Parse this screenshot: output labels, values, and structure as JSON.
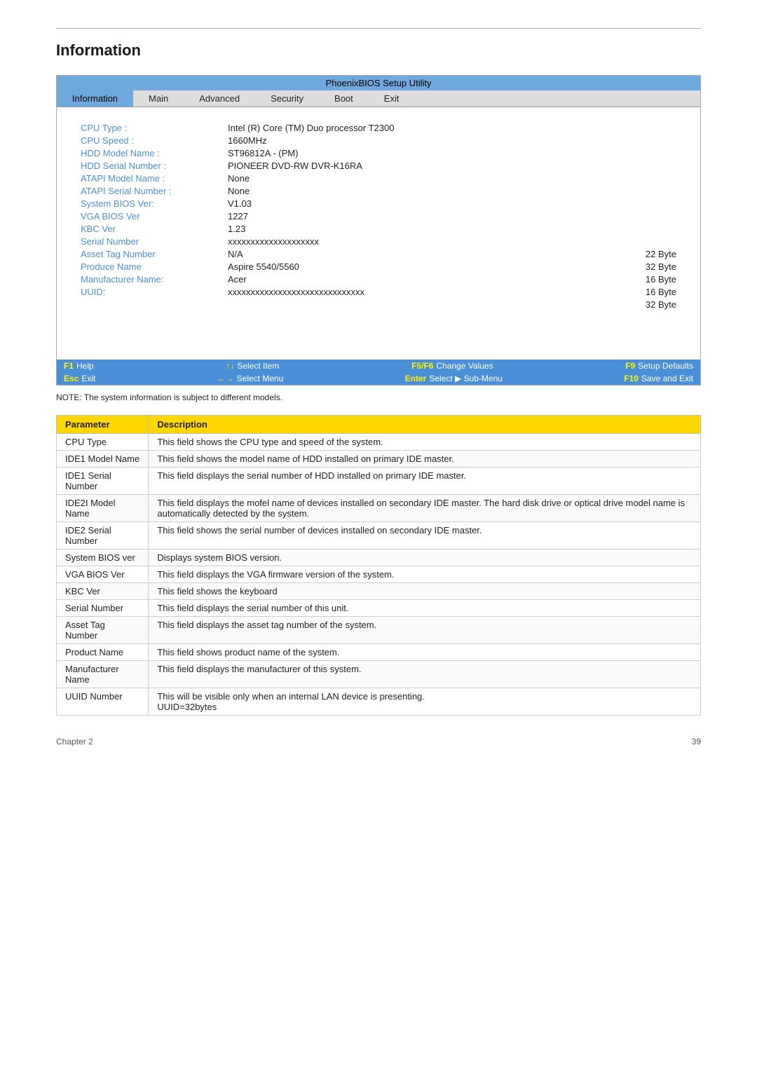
{
  "page": {
    "title": "Information",
    "chapter": "Chapter 2",
    "page_number": "39"
  },
  "bios": {
    "title_bar": "PhoenixBIOS Setup Utility",
    "nav_items": [
      {
        "label": "Information",
        "active": true
      },
      {
        "label": "Main",
        "active": false
      },
      {
        "label": "Advanced",
        "active": false
      },
      {
        "label": "Security",
        "active": false
      },
      {
        "label": "Boot",
        "active": false
      },
      {
        "label": "Exit",
        "active": false
      }
    ],
    "fields": [
      {
        "label": "CPU Type :",
        "value": "Intel (R) Core (TM) Duo processor T2300",
        "byte": ""
      },
      {
        "label": "CPU Speed :",
        "value": "1660MHz",
        "byte": ""
      },
      {
        "label": "HDD Model Name :",
        "value": "ST96812A - (PM)",
        "byte": ""
      },
      {
        "label": "HDD Serial Number :",
        "value": "PIONEER DVD-RW DVR-K16RA",
        "byte": ""
      },
      {
        "label": "ATAPI Model Name :",
        "value": "None",
        "byte": ""
      },
      {
        "label": "ATAPI Serial Number :",
        "value": "None",
        "byte": ""
      },
      {
        "label": "System BIOS Ver:",
        "value": "V1.03",
        "byte": ""
      },
      {
        "label": "VGA BIOS Ver",
        "value": "1227",
        "byte": ""
      },
      {
        "label": "KBC Ver",
        "value": "1.23",
        "byte": ""
      },
      {
        "label": "Serial Number",
        "value": "xxxxxxxxxxxxxxxxxxxx",
        "byte": ""
      },
      {
        "label": "Asset Tag Number",
        "value": "N/A",
        "byte": "22 Byte"
      },
      {
        "label": "Produce Name",
        "value": "Aspire 5540/5560",
        "byte": "32 Byte"
      },
      {
        "label": "Manufacturer Name:",
        "value": "Acer",
        "byte": "16 Byte"
      },
      {
        "label": "UUID:",
        "value": "xxxxxxxxxxxxxxxxxxxxxxxxxxxxxx",
        "byte": "16 Byte"
      },
      {
        "label": "",
        "value": "",
        "byte": "32 Byte"
      }
    ],
    "status_rows": [
      [
        {
          "key": "F1",
          "desc": "Help"
        },
        {
          "key": "↑↓",
          "desc": "Select Item"
        },
        {
          "key": "F5/F6",
          "desc": "Change Values"
        },
        {
          "key": "F9",
          "desc": "Setup Defaults"
        }
      ],
      [
        {
          "key": "Esc",
          "desc": "Exit"
        },
        {
          "key": "←→",
          "desc": "Select Menu"
        },
        {
          "key": "Enter",
          "desc": "Select ▶ Sub-Menu"
        },
        {
          "key": "F10",
          "desc": "Save and Exit"
        }
      ]
    ]
  },
  "note": "NOTE: The system information is subject to different models.",
  "table": {
    "headers": [
      "Parameter",
      "Description"
    ],
    "rows": [
      {
        "param": "CPU Type",
        "desc": "This field shows the CPU type and speed of the system."
      },
      {
        "param": "IDE1 Model Name",
        "desc": "This field shows the model name of HDD installed on primary IDE master."
      },
      {
        "param": "IDE1 Serial Number",
        "desc": "This field displays the serial number of HDD installed on primary IDE master."
      },
      {
        "param": "IDE2I Model Name",
        "desc": "This field displays the mofel name of devices installed on secondary IDE master. The hard disk drive or optical drive model name is automatically detected by the system."
      },
      {
        "param": "IDE2 Serial Number",
        "desc": "This field shows the serial number of devices installed on secondary IDE master."
      },
      {
        "param": "System BIOS ver",
        "desc": "Displays system BIOS version."
      },
      {
        "param": "VGA BIOS Ver",
        "desc": "This field displays the VGA firmware version of the system."
      },
      {
        "param": "KBC Ver",
        "desc": "This field shows the keyboard"
      },
      {
        "param": "Serial Number",
        "desc": "This field displays the serial number of this unit."
      },
      {
        "param": "Asset Tag Number",
        "desc": "This field displays the asset tag number of the system."
      },
      {
        "param": "Product Name",
        "desc": "This field shows product name of the system."
      },
      {
        "param": "Manufacturer Name",
        "desc": "This field displays the manufacturer of this system."
      },
      {
        "param": "UUID Number",
        "desc": "This will be visible only when an internal LAN device is presenting.\nUUID=32bytes"
      }
    ]
  }
}
